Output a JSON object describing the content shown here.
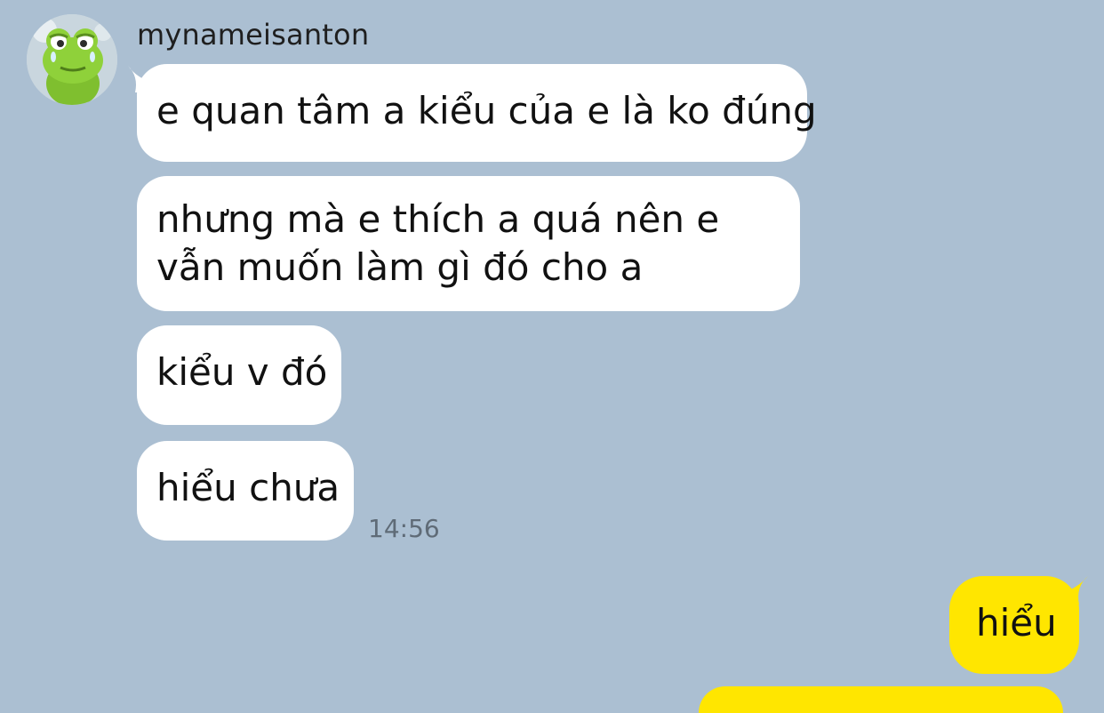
{
  "conversation": {
    "sender_name": "mynameisanton",
    "incoming": [
      {
        "text": "e quan tâm a kiểu của e là ko đúng"
      },
      {
        "text": "nhưng mà e thích a quá nên e vẫn muốn làm gì đó cho a"
      },
      {
        "text": "kiểu v đó"
      },
      {
        "text": "hiểu chưa"
      }
    ],
    "incoming_time": "14:56",
    "outgoing": [
      {
        "text": "hiểu"
      }
    ]
  },
  "colors": {
    "background": "#abbfd2",
    "incoming_bubble": "#ffffff",
    "outgoing_bubble": "#ffe600",
    "timestamp": "#5f6b77"
  },
  "icons": {
    "avatar": "green-frog-character-avatar"
  }
}
